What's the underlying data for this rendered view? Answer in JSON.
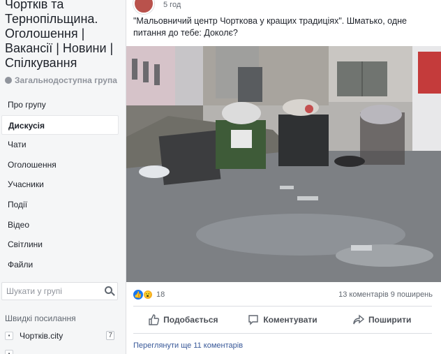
{
  "group": {
    "title": "Чортків та Тернопільщина. Оголошення | Вакансії | Новини | Спілкування",
    "type": "Загальнодоступна група"
  },
  "nav": {
    "items": [
      {
        "label": "Про групу"
      },
      {
        "label": "Дискусія"
      },
      {
        "label": "Чати"
      },
      {
        "label": "Оголошення"
      },
      {
        "label": "Учасники"
      },
      {
        "label": "Події"
      },
      {
        "label": "Відео"
      },
      {
        "label": "Світлини"
      },
      {
        "label": "Файли"
      }
    ],
    "active_index": 1
  },
  "search": {
    "placeholder": "Шукати у групі"
  },
  "quick_links": {
    "title": "Швидкі посилання",
    "items": [
      {
        "label": "Чортків.city",
        "count": "7"
      }
    ]
  },
  "post": {
    "time": "5 год",
    "text": "\"Мальовничий центр Чорткова у кращих традиціях\". Шматько, одне питання до тебе: Доколє?",
    "reactions_count": "18",
    "comments_shares": "13 коментарів  9 поширень",
    "actions": {
      "like": "Подобається",
      "comment": "Коментувати",
      "share": "Поширити"
    },
    "more_comments": "Переглянути ще 11 коментарів"
  },
  "colors": {
    "link": "#385898",
    "accent": "#1877f2",
    "sidebar_bg": "#f5f6f7"
  }
}
